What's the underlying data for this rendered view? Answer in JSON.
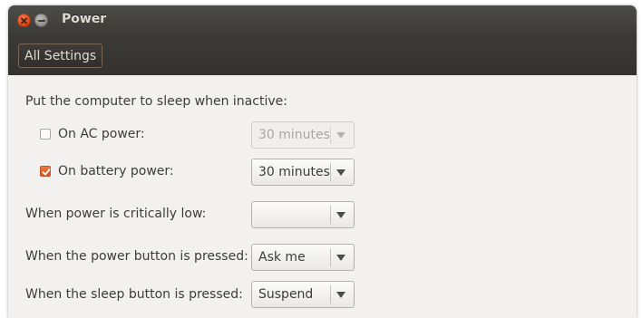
{
  "window": {
    "title": "Power"
  },
  "toolbar": {
    "all_settings_label": "All Settings"
  },
  "sleep": {
    "heading": "Put the computer to sleep when inactive:",
    "ac": {
      "label": "On AC power:",
      "checked": false,
      "value": "30 minutes",
      "enabled": false
    },
    "battery": {
      "label": "On battery power:",
      "checked": true,
      "value": "30 minutes",
      "enabled": true
    }
  },
  "critical": {
    "label": "When power is critically low:",
    "value": ""
  },
  "power_button": {
    "label": "When the power button is pressed:",
    "value": "Ask me"
  },
  "sleep_button": {
    "label": "When the sleep button is pressed:",
    "value": "Suspend"
  },
  "colors": {
    "accent": "#e05a1c",
    "titlebar": "#3b3a36",
    "background": "#f2f1f0"
  }
}
